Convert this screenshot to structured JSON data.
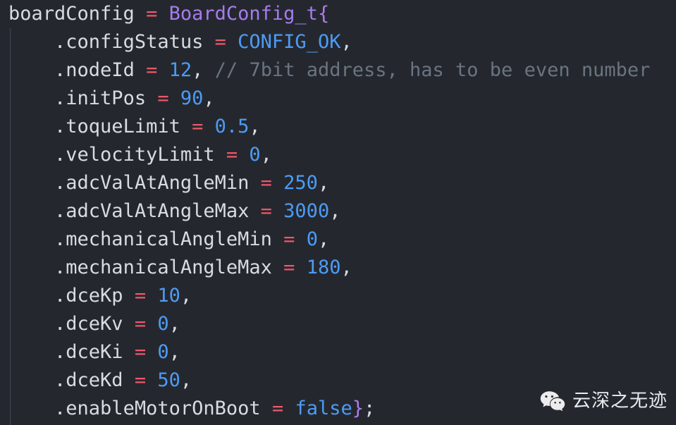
{
  "editor": {
    "language": "c",
    "theme": "dark",
    "background_color": "#24282e",
    "default_text_color": "#d7dce3",
    "indent_guide_color": "#44505c",
    "colors": {
      "type": "#a77bf0",
      "brace": "#b07ce8",
      "operator": "#f0566a",
      "number": "#4d9bf5",
      "constant": "#4d9bf5",
      "boolean": "#4d9bf5",
      "comment": "#6a7480",
      "plain": "#d7dce3"
    }
  },
  "code": {
    "lines": [
      {
        "indent": 0,
        "tokens": [
          {
            "t": "boardConfig",
            "c": "plain"
          },
          {
            "t": " ",
            "c": "plain"
          },
          {
            "t": "=",
            "c": "op"
          },
          {
            "t": " ",
            "c": "plain"
          },
          {
            "t": "BoardConfig_t",
            "c": "type"
          },
          {
            "t": "{",
            "c": "brace"
          }
        ]
      },
      {
        "indent": 1,
        "tokens": [
          {
            "t": ".configStatus",
            "c": "prop"
          },
          {
            "t": " ",
            "c": "plain"
          },
          {
            "t": "=",
            "c": "op"
          },
          {
            "t": " ",
            "c": "plain"
          },
          {
            "t": "CONFIG_OK",
            "c": "const"
          },
          {
            "t": ",",
            "c": "punct"
          }
        ]
      },
      {
        "indent": 1,
        "tokens": [
          {
            "t": ".nodeId",
            "c": "prop"
          },
          {
            "t": " ",
            "c": "plain"
          },
          {
            "t": "=",
            "c": "op"
          },
          {
            "t": " ",
            "c": "plain"
          },
          {
            "t": "12",
            "c": "num"
          },
          {
            "t": ",",
            "c": "punct"
          },
          {
            "t": " ",
            "c": "plain"
          },
          {
            "t": "// 7bit address, has to be even number",
            "c": "comment"
          }
        ]
      },
      {
        "indent": 1,
        "tokens": [
          {
            "t": ".initPos",
            "c": "prop"
          },
          {
            "t": " ",
            "c": "plain"
          },
          {
            "t": "=",
            "c": "op"
          },
          {
            "t": " ",
            "c": "plain"
          },
          {
            "t": "90",
            "c": "num"
          },
          {
            "t": ",",
            "c": "punct"
          }
        ]
      },
      {
        "indent": 1,
        "tokens": [
          {
            "t": ".toqueLimit",
            "c": "prop"
          },
          {
            "t": " ",
            "c": "plain"
          },
          {
            "t": "=",
            "c": "op"
          },
          {
            "t": " ",
            "c": "plain"
          },
          {
            "t": "0.5",
            "c": "num"
          },
          {
            "t": ",",
            "c": "punct"
          }
        ]
      },
      {
        "indent": 1,
        "tokens": [
          {
            "t": ".velocityLimit",
            "c": "prop"
          },
          {
            "t": " ",
            "c": "plain"
          },
          {
            "t": "=",
            "c": "op"
          },
          {
            "t": " ",
            "c": "plain"
          },
          {
            "t": "0",
            "c": "num"
          },
          {
            "t": ",",
            "c": "punct"
          }
        ]
      },
      {
        "indent": 1,
        "tokens": [
          {
            "t": ".adcValAtAngleMin",
            "c": "prop"
          },
          {
            "t": " ",
            "c": "plain"
          },
          {
            "t": "=",
            "c": "op"
          },
          {
            "t": " ",
            "c": "plain"
          },
          {
            "t": "250",
            "c": "num"
          },
          {
            "t": ",",
            "c": "punct"
          }
        ]
      },
      {
        "indent": 1,
        "tokens": [
          {
            "t": ".adcValAtAngleMax",
            "c": "prop"
          },
          {
            "t": " ",
            "c": "plain"
          },
          {
            "t": "=",
            "c": "op"
          },
          {
            "t": " ",
            "c": "plain"
          },
          {
            "t": "3000",
            "c": "num"
          },
          {
            "t": ",",
            "c": "punct"
          }
        ]
      },
      {
        "indent": 1,
        "tokens": [
          {
            "t": ".mechanicalAngleMin",
            "c": "prop"
          },
          {
            "t": " ",
            "c": "plain"
          },
          {
            "t": "=",
            "c": "op"
          },
          {
            "t": " ",
            "c": "plain"
          },
          {
            "t": "0",
            "c": "num"
          },
          {
            "t": ",",
            "c": "punct"
          }
        ]
      },
      {
        "indent": 1,
        "tokens": [
          {
            "t": ".mechanicalAngleMax",
            "c": "prop"
          },
          {
            "t": " ",
            "c": "plain"
          },
          {
            "t": "=",
            "c": "op"
          },
          {
            "t": " ",
            "c": "plain"
          },
          {
            "t": "180",
            "c": "num"
          },
          {
            "t": ",",
            "c": "punct"
          }
        ]
      },
      {
        "indent": 1,
        "tokens": [
          {
            "t": ".dceKp",
            "c": "prop"
          },
          {
            "t": " ",
            "c": "plain"
          },
          {
            "t": "=",
            "c": "op"
          },
          {
            "t": " ",
            "c": "plain"
          },
          {
            "t": "10",
            "c": "num"
          },
          {
            "t": ",",
            "c": "punct"
          }
        ]
      },
      {
        "indent": 1,
        "tokens": [
          {
            "t": ".dceKv",
            "c": "prop"
          },
          {
            "t": " ",
            "c": "plain"
          },
          {
            "t": "=",
            "c": "op"
          },
          {
            "t": " ",
            "c": "plain"
          },
          {
            "t": "0",
            "c": "num"
          },
          {
            "t": ",",
            "c": "punct"
          }
        ]
      },
      {
        "indent": 1,
        "tokens": [
          {
            "t": ".dceKi",
            "c": "prop"
          },
          {
            "t": " ",
            "c": "plain"
          },
          {
            "t": "=",
            "c": "op"
          },
          {
            "t": " ",
            "c": "plain"
          },
          {
            "t": "0",
            "c": "num"
          },
          {
            "t": ",",
            "c": "punct"
          }
        ]
      },
      {
        "indent": 1,
        "tokens": [
          {
            "t": ".dceKd",
            "c": "prop"
          },
          {
            "t": " ",
            "c": "plain"
          },
          {
            "t": "=",
            "c": "op"
          },
          {
            "t": " ",
            "c": "plain"
          },
          {
            "t": "50",
            "c": "num"
          },
          {
            "t": ",",
            "c": "punct"
          }
        ]
      },
      {
        "indent": 1,
        "tokens": [
          {
            "t": ".enableMotorOnBoot",
            "c": "prop"
          },
          {
            "t": " ",
            "c": "plain"
          },
          {
            "t": "=",
            "c": "op"
          },
          {
            "t": " ",
            "c": "plain"
          },
          {
            "t": "false",
            "c": "bool"
          },
          {
            "t": "}",
            "c": "brace"
          },
          {
            "t": ";",
            "c": "punct"
          }
        ]
      }
    ]
  },
  "watermark": {
    "icon": "wechat-icon",
    "text": "云深之无迹"
  }
}
